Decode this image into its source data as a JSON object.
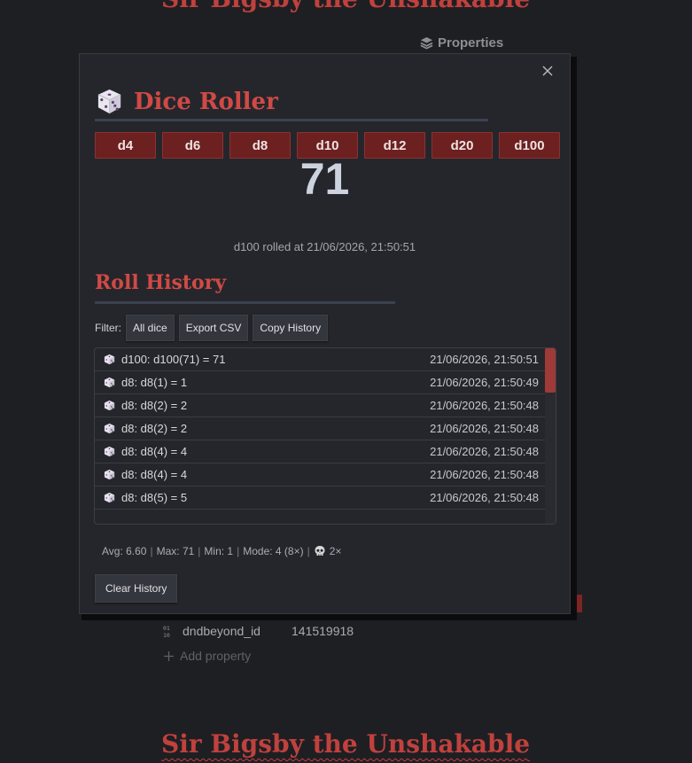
{
  "background": {
    "note_title": "Sir Bigsby the Unshakable",
    "properties_label": "Properties",
    "property": {
      "key": "dndbeyond_id",
      "value": "141519918"
    },
    "add_property_label": "Add property"
  },
  "modal": {
    "title": "Dice Roller",
    "dice": [
      "d4",
      "d6",
      "d8",
      "d10",
      "d12",
      "d20",
      "d100"
    ],
    "result": "71",
    "rolled_at": "d100 rolled at 21/06/2026, 21:50:51",
    "history_title": "Roll History",
    "filter_label": "Filter:",
    "filter_value": "All dice",
    "export_label": "Export CSV",
    "copy_label": "Copy History",
    "history": [
      {
        "text": "d100: d100(71) = 71",
        "time": "21/06/2026, 21:50:51"
      },
      {
        "text": "d8: d8(1) = 1",
        "time": "21/06/2026, 21:50:49"
      },
      {
        "text": "d8: d8(2) = 2",
        "time": "21/06/2026, 21:50:48"
      },
      {
        "text": "d8: d8(2) = 2",
        "time": "21/06/2026, 21:50:48"
      },
      {
        "text": "d8: d8(4) = 4",
        "time": "21/06/2026, 21:50:48"
      },
      {
        "text": "d8: d8(4) = 4",
        "time": "21/06/2026, 21:50:48"
      },
      {
        "text": "d8: d8(5) = 5",
        "time": "21/06/2026, 21:50:48"
      }
    ],
    "stats": {
      "avg": "Avg: 6.60",
      "max": "Max: 71",
      "min": "Min: 1",
      "mode": "Mode: 4 (8×)",
      "crit_fails": "2×"
    },
    "clear_label": "Clear History"
  },
  "colors": {
    "accent_red": "#d04a45",
    "die_button": "#6c2020",
    "scroll_thumb": "#9e3a37"
  }
}
